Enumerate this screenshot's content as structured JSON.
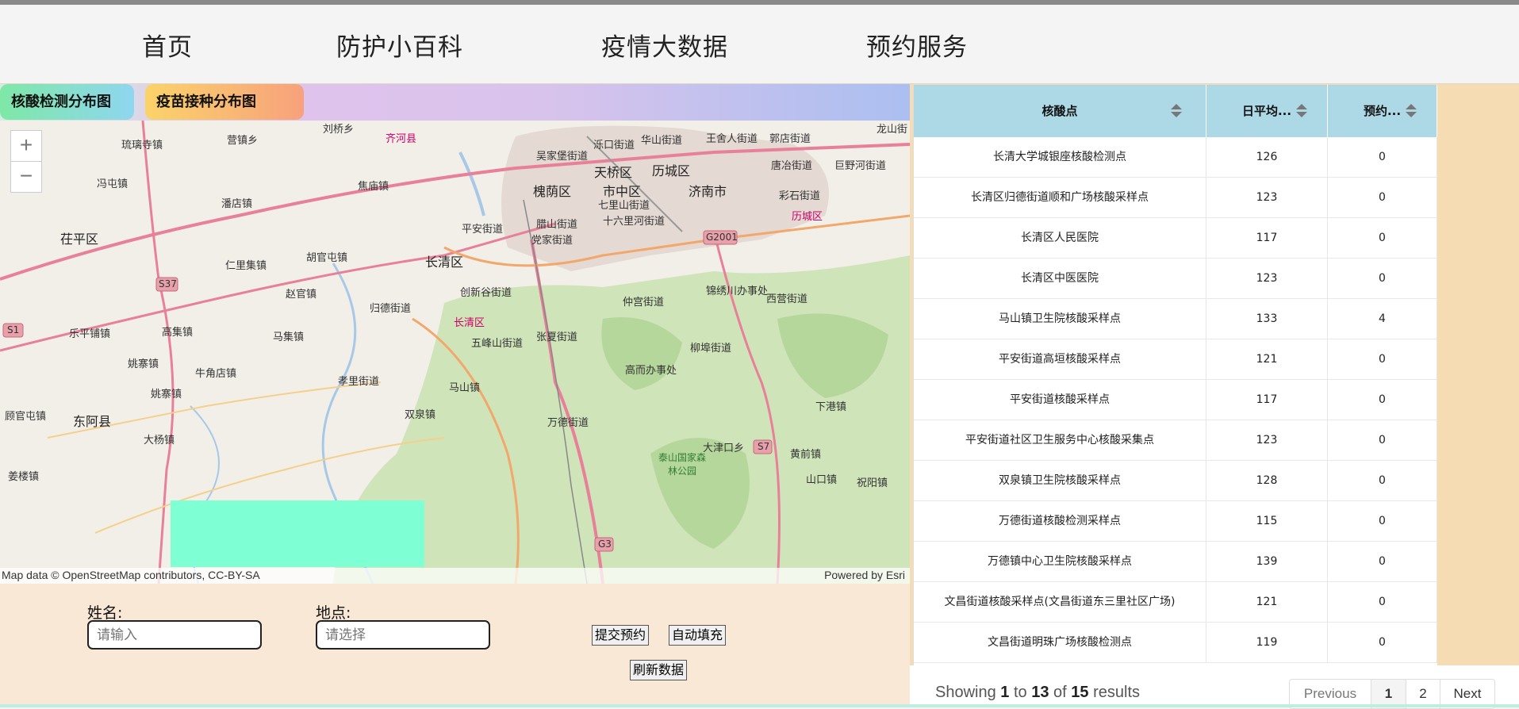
{
  "nav": {
    "items": [
      "首页",
      "防护小百科",
      "疫情大数据",
      "预约服务"
    ]
  },
  "tabs": [
    "核酸检测分布图",
    "疫苗接种分布图"
  ],
  "map": {
    "zoom_in": "+",
    "zoom_out": "−",
    "attribution_left": "Map data © OpenStreetMap contributors, CC-BY-SA",
    "attribution_right": "Powered by Esri",
    "places": [
      "刘桥乡",
      "齐河县",
      "龙山街",
      "琉璃寺镇",
      "营镇乡",
      "吴家堡街道",
      "泺口街道",
      "华山街道",
      "王舍人街道",
      "郭店街道",
      "冯屯镇",
      "焦庙镇",
      "天桥区",
      "历城区",
      "唐冶街道",
      "巨野河街道",
      "潘店镇",
      "槐荫区",
      "市中区",
      "济南市",
      "七里山街道",
      "彩石街道",
      "茌平区",
      "腊山街道",
      "十六里河街道",
      "历城区",
      "平安街道",
      "党家街道",
      "仁里集镇",
      "胡官屯镇",
      "长清区",
      "S37",
      "G2001",
      "S1",
      "赵官镇",
      "创新谷街道",
      "锦绣川办事处",
      "归德街道",
      "仲宫街道",
      "西营街道",
      "乐平铺镇",
      "马集镇",
      "长清区",
      "张夏街道",
      "五峰山街道",
      "柳埠街道",
      "高集镇",
      "姚寨镇",
      "牛角店镇",
      "高而办事处",
      "孝里街道",
      "马山镇",
      "S7",
      "姚寨镇",
      "顾官屯镇",
      "双泉镇",
      "万德街道",
      "下港镇",
      "东阿县",
      "大杨镇",
      "大津口乡",
      "黄前镇",
      "姜楼镇",
      "泰山国家森林公园",
      "G3",
      "山口镇",
      "祝阳镇"
    ]
  },
  "form": {
    "name_label": "姓名:",
    "name_placeholder": "请输入",
    "place_label": "地点:",
    "place_placeholder": "请选择",
    "submit": "提交预约",
    "autofill": "自动填充",
    "refresh": "刷新数据"
  },
  "table": {
    "headers": [
      "核酸点",
      "日平均...",
      "预约..."
    ],
    "rows": [
      [
        "长清大学城银座核酸检测点",
        "126",
        "0"
      ],
      [
        "长清区归德街道顺和广场核酸采样点",
        "123",
        "0"
      ],
      [
        "长清区人民医院",
        "117",
        "0"
      ],
      [
        "长清区中医医院",
        "123",
        "0"
      ],
      [
        "马山镇卫生院核酸采样点",
        "133",
        "4"
      ],
      [
        "平安街道高垣核酸采样点",
        "121",
        "0"
      ],
      [
        "平安街道核酸采样点",
        "117",
        "0"
      ],
      [
        "平安街道社区卫生服务中心核酸采集点",
        "123",
        "0"
      ],
      [
        "双泉镇卫生院核酸采样点",
        "128",
        "0"
      ],
      [
        "万德街道核酸检测采样点",
        "115",
        "0"
      ],
      [
        "万德镇中心卫生院核酸采样点",
        "139",
        "0"
      ],
      [
        "文昌街道核酸采样点(文昌街道东三里社区广场)",
        "121",
        "0"
      ],
      [
        "文昌街道明珠广场核酸检测点",
        "119",
        "0"
      ]
    ]
  },
  "pagination": {
    "showing_prefix": "Showing",
    "from": "1",
    "to_word": "to",
    "to": "13",
    "of_word": "of",
    "total": "15",
    "suffix": "results",
    "previous": "Previous",
    "page1": "1",
    "page2": "2",
    "next": "Next"
  },
  "colors": {
    "table_header": "#add8e6",
    "overlay": "#7fffd4",
    "form_bg": "#f9e8d6",
    "right_bg": "#f6dcb3"
  }
}
